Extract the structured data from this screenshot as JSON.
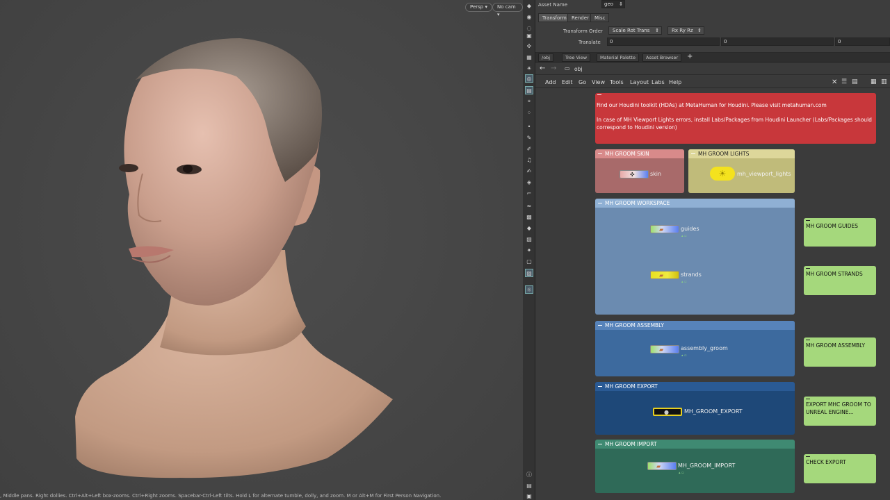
{
  "viewport": {
    "persp_label": "Persp",
    "cam_label": "No cam",
    "status_text": ", Middle pans. Right dollies. Ctrl+Alt+Left box-zooms. Ctrl+Right zooms. Spacebar-Ctrl-Left tilts. Hold L for alternate tumble, dolly, and zoom. M or Alt+M for First Person Navigation."
  },
  "params": {
    "asset_name_label": "Asset Name",
    "asset_name_value": "geo",
    "tabs": [
      "Transform",
      "Render",
      "Misc"
    ],
    "transform_order_label": "Transform Order",
    "transform_order_value": "Scale Rot Trans",
    "rot_order_value": "Rx Ry Rz",
    "translate_label": "Translate",
    "translate_values": [
      "0",
      "0",
      "0"
    ]
  },
  "network_tabs": [
    "/obj",
    "Tree View",
    "Material Palette",
    "Asset Browser"
  ],
  "path": {
    "value": "obj"
  },
  "menu": [
    "Add",
    "Edit",
    "Go",
    "View",
    "Tools",
    "Layout",
    "Labs",
    "Help"
  ],
  "network": {
    "banner": {
      "line1": "Find our Houdini toolkit (HDAs) at MetaHuman for Houdini. Please visit metahuman.com",
      "line2": "In case of MH Viewport Lights errors, install Labs/Packages from Houdini Launcher (Labs/Packages should correspond to Houdini version)"
    },
    "boxes": {
      "skin": "MH GROOM SKIN",
      "lights": "MH GROOM LIGHTS",
      "workspace": "MH GROOM WORKSPACE",
      "assembly": "MH GROOM ASSEMBLY",
      "export": "MH GROOM EXPORT",
      "import": "MH GROOM IMPORT"
    },
    "nodes": {
      "skin": "skin",
      "lights": "mh_viewport_lights",
      "guides": "guides",
      "strands": "strands",
      "assembly": "assembly_groom",
      "export": "MH_GROOM_EXPORT",
      "import": "MH_GROOM_IMPORT"
    },
    "stickies": {
      "guides": "MH GROOM GUIDES",
      "strands": "MH GROOM STRANDS",
      "assembly": "MH GROOM ASSEMBLY",
      "export": "EXPORT MHC GROOM TO UNREAL ENGINE...",
      "check": "CHECK EXPORT"
    }
  },
  "colors": {
    "banner": "#c8373b",
    "skin_box": "#a86a6a",
    "lights_box": "#c0bb7a",
    "workspace_box": "#6b8bb0",
    "assembly_box": "#3d6a9e",
    "export_box": "#1e4878",
    "import_box": "#2f6a58",
    "sticky": "#a5d87c"
  }
}
